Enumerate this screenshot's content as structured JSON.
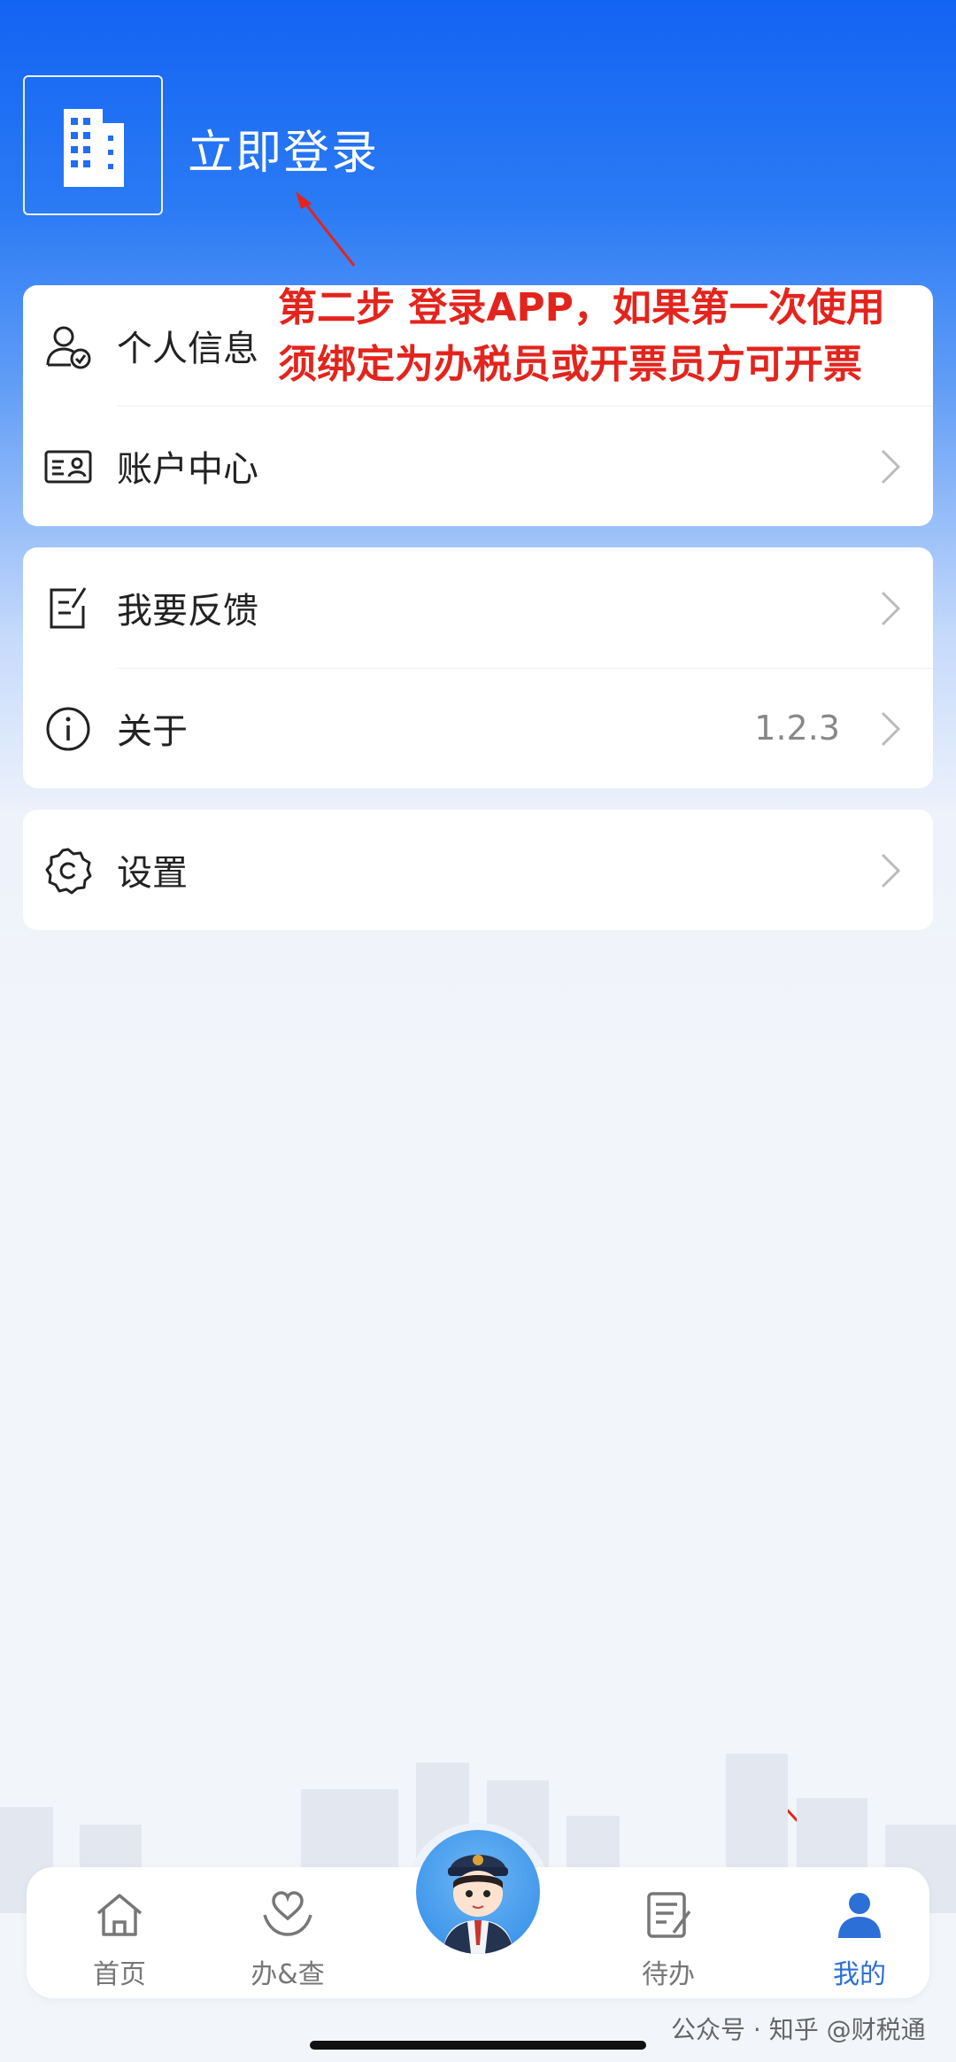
{
  "header": {
    "login_label": "立即登录"
  },
  "annotation": {
    "line1": "第二步 登录APP，如果第一次使用",
    "line2": "须绑定为办税员或开票员方可开票"
  },
  "menu": {
    "personal_info": "个人信息",
    "account_center": "账户中心",
    "feedback": "我要反馈",
    "about": "关于",
    "about_version": "1.2.3",
    "settings": "设置"
  },
  "tabbar": {
    "home": "首页",
    "handle_query": "办&查",
    "todo": "待办",
    "mine": "我的"
  },
  "watermark": "公众号 · 知乎 @财税通",
  "colors": {
    "brand_blue": "#1463f3",
    "annotation_red": "#e3241d",
    "active_tab": "#2c6fd6"
  },
  "icons": [
    "building-icon",
    "user-check-icon",
    "id-card-icon",
    "edit-note-icon",
    "info-icon",
    "gear-icon",
    "chevron-right-icon",
    "home-icon",
    "heart-hand-icon",
    "todo-list-icon",
    "person-icon"
  ]
}
